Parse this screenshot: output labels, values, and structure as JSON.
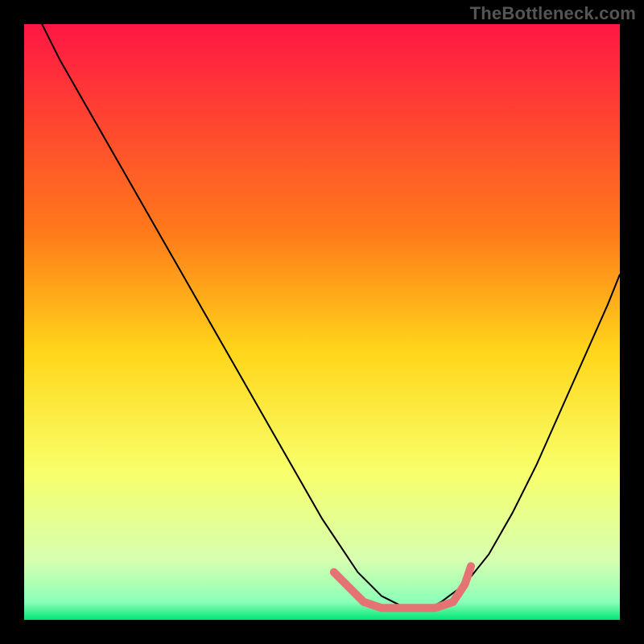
{
  "watermark": "TheBottleneck.com",
  "chart_data": {
    "type": "line",
    "title": "",
    "xlabel": "",
    "ylabel": "",
    "xlim": [
      0,
      100
    ],
    "ylim": [
      0,
      100
    ],
    "grid": false,
    "gradient_stops": [
      {
        "offset": 0,
        "color": "#ff1744"
      },
      {
        "offset": 35,
        "color": "#ff7a1a"
      },
      {
        "offset": 55,
        "color": "#ffd61a"
      },
      {
        "offset": 75,
        "color": "#f8ff6a"
      },
      {
        "offset": 90,
        "color": "#d6ffb0"
      },
      {
        "offset": 97,
        "color": "#8cffb8"
      },
      {
        "offset": 100,
        "color": "#00e676"
      }
    ],
    "series": [
      {
        "name": "bottleneck-curve",
        "stroke": "#000000",
        "stroke_width": 2,
        "x": [
          3,
          6,
          10,
          14,
          18,
          22,
          26,
          30,
          34,
          38,
          42,
          46,
          50,
          54,
          56,
          58,
          60,
          62,
          64,
          66,
          68,
          70,
          74,
          78,
          82,
          86,
          90,
          94,
          98,
          100
        ],
        "y": [
          100,
          94,
          87,
          80,
          73,
          66,
          59,
          52,
          45,
          38,
          31,
          24,
          17,
          11,
          8,
          6,
          4,
          3,
          2,
          2,
          2,
          3,
          6,
          11,
          18,
          26,
          35,
          44,
          53,
          58
        ]
      },
      {
        "name": "ideal-zone",
        "stroke": "#e57373",
        "stroke_width": 10,
        "linecap": "round",
        "x": [
          52,
          55,
          57,
          60,
          63,
          66,
          69,
          72,
          74,
          75
        ],
        "y": [
          8,
          5,
          3,
          2,
          2,
          2,
          2,
          3,
          6,
          9
        ]
      }
    ]
  }
}
